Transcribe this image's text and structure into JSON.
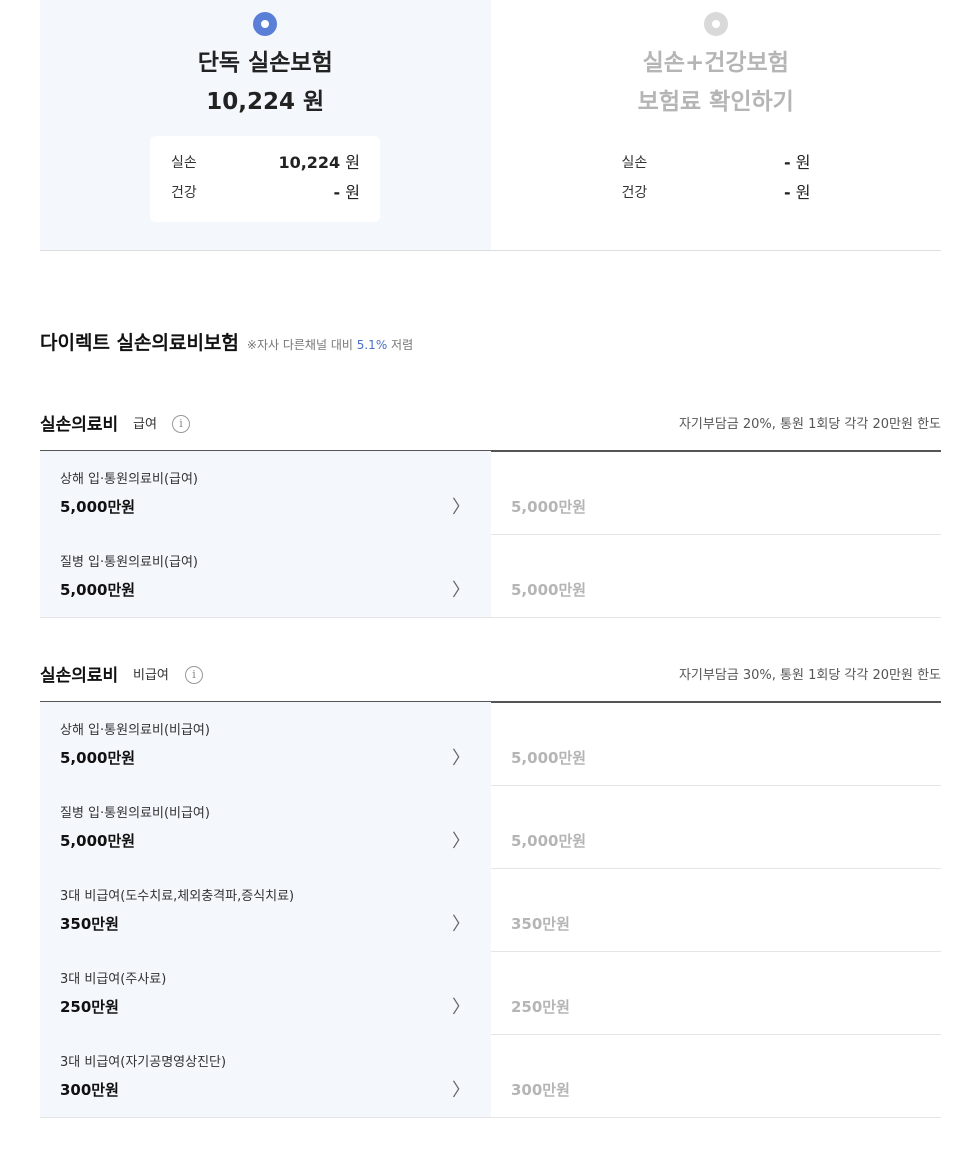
{
  "plans": [
    {
      "name": "단독 실손보험",
      "price": "10,224 원",
      "breakdown": [
        {
          "label": "실손",
          "value_num": "10,224",
          "unit": " 원"
        },
        {
          "label": "건강",
          "value_num": "-",
          "unit": " 원"
        }
      ]
    },
    {
      "name": "실손+건강보험",
      "price": "보험료 확인하기",
      "breakdown": [
        {
          "label": "실손",
          "value_num": "-",
          "unit": " 원"
        },
        {
          "label": "건강",
          "value_num": "-",
          "unit": " 원"
        }
      ]
    }
  ],
  "product": {
    "title": "다이렉트 실손의료비보험",
    "note_prefix": "※자사 다른채널 대비 ",
    "note_highlight": "5.1%",
    "note_suffix": " 저렴"
  },
  "sections": [
    {
      "title": "실손의료비",
      "subtitle": "급여",
      "info": "i",
      "right_text": "자기부담금 20%, 통원 1회당 각각 20만원 한도",
      "rows": [
        {
          "name": "상해 입·통원의료비(급여)",
          "amount": "5,000만원",
          "compare": "5,000만원"
        },
        {
          "name": "질병 입·통원의료비(급여)",
          "amount": "5,000만원",
          "compare": "5,000만원"
        }
      ]
    },
    {
      "title": "실손의료비",
      "subtitle": "비급여",
      "info": "i",
      "right_text": "자기부담금 30%, 통원 1회당 각각 20만원 한도",
      "rows": [
        {
          "name": "상해 입·통원의료비(비급여)",
          "amount": "5,000만원",
          "compare": "5,000만원"
        },
        {
          "name": "질병 입·통원의료비(비급여)",
          "amount": "5,000만원",
          "compare": "5,000만원"
        },
        {
          "name": "3대 비급여(도수치료,체외충격파,증식치료)",
          "amount": "350만원",
          "compare": "350만원"
        },
        {
          "name": "3대 비급여(주사료)",
          "amount": "250만원",
          "compare": "250만원"
        },
        {
          "name": "3대 비급여(자기공명영상진단)",
          "amount": "300만원",
          "compare": "300만원"
        }
      ]
    }
  ],
  "chevron": "〉",
  "colors": {
    "accent": "#5a7fd6",
    "plan_bg": "#f4f7fc",
    "muted": "#b5b5b5",
    "highlight": "#4a6fc8"
  }
}
